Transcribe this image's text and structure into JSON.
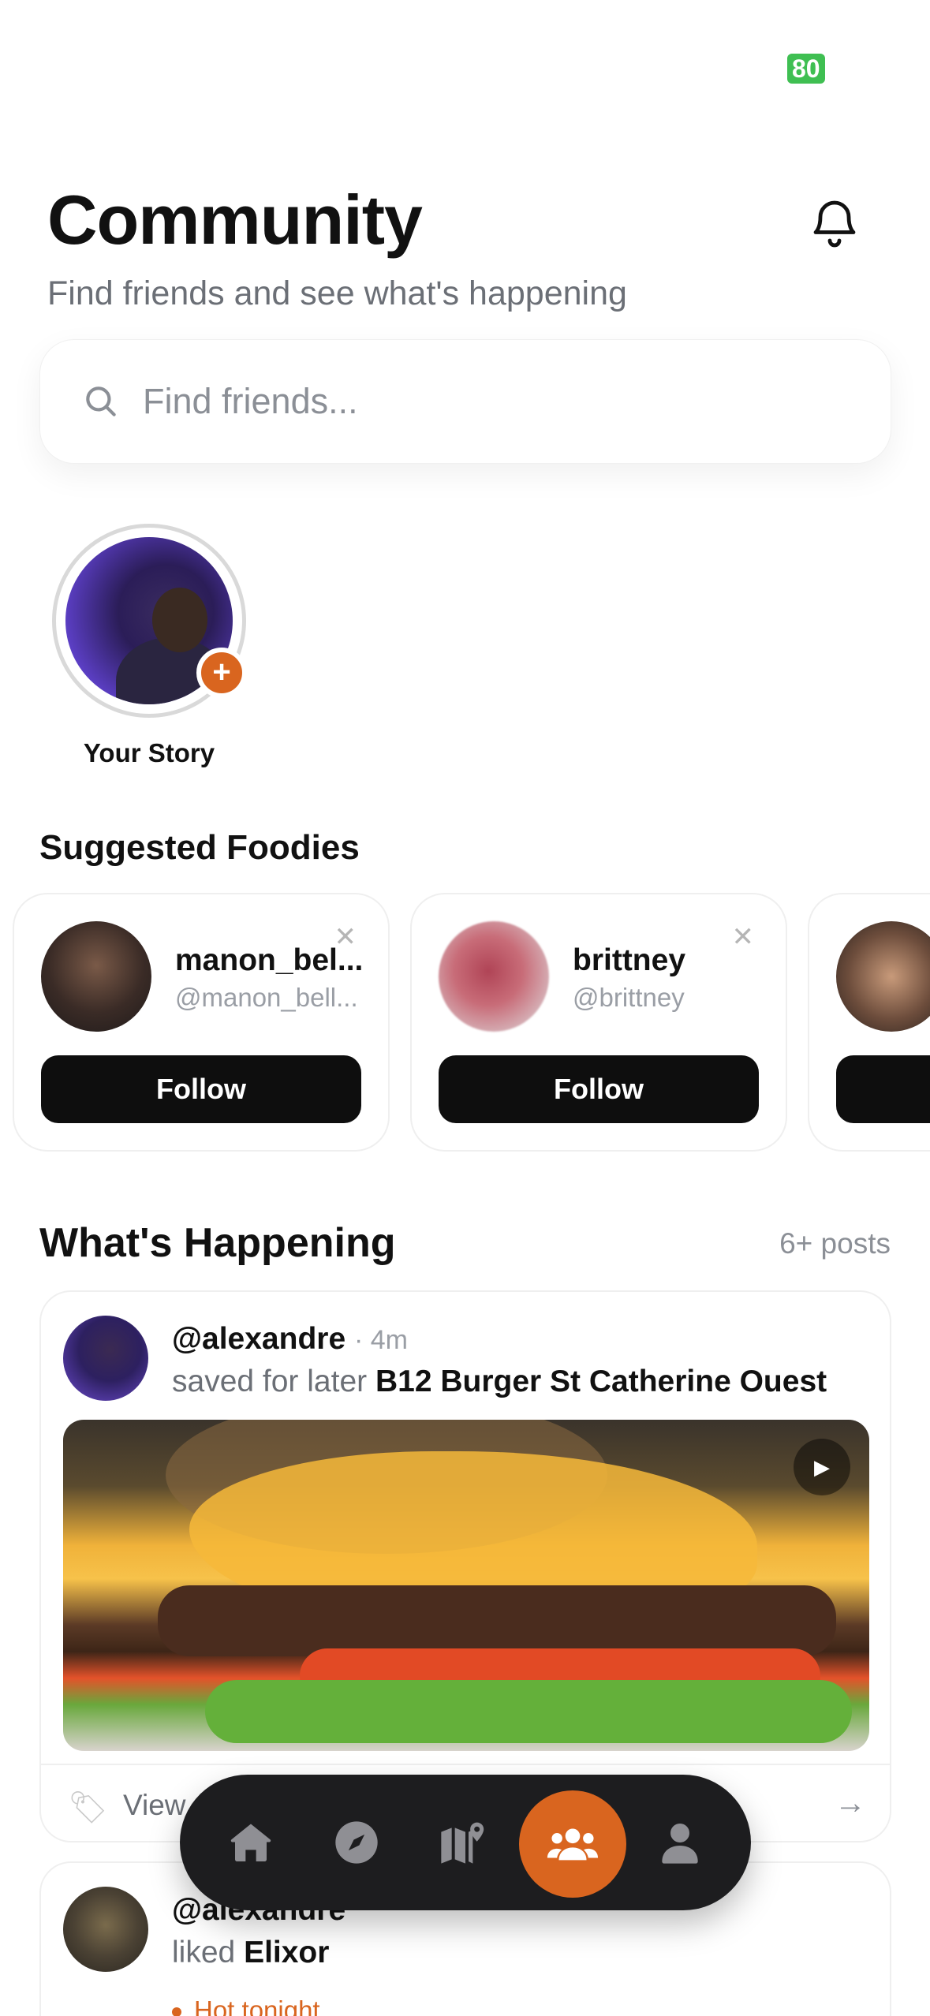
{
  "status": {
    "battery": "80"
  },
  "header": {
    "title": "Community",
    "subtitle": "Find friends and see what's happening"
  },
  "search": {
    "placeholder": "Find friends..."
  },
  "stories": {
    "your_story_label": "Your Story"
  },
  "suggested": {
    "title": "Suggested Foodies",
    "follow_label": "Follow",
    "users": [
      {
        "name": "manon_bel...",
        "handle": "@manon_bell..."
      },
      {
        "name": "brittney",
        "handle": "@brittney"
      }
    ]
  },
  "happening": {
    "title": "What's Happening",
    "count": "6+ posts",
    "posts": [
      {
        "user": "@alexandre",
        "time": "4m",
        "action": "saved for later",
        "place": "B12 Burger St Catherine Ouest",
        "footer_text": "View"
      },
      {
        "user": "@alexandre",
        "action": "liked",
        "place": "Elixor",
        "badge": "Hot tonight"
      }
    ]
  },
  "tabbar": {
    "items": [
      "home-icon",
      "compass-icon",
      "map-icon",
      "community-icon",
      "profile-icon"
    ],
    "active": "community-icon"
  },
  "colors": {
    "accent": "#d9651f",
    "button": "#0e0e0e",
    "tabbar": "#1d1d1f"
  }
}
